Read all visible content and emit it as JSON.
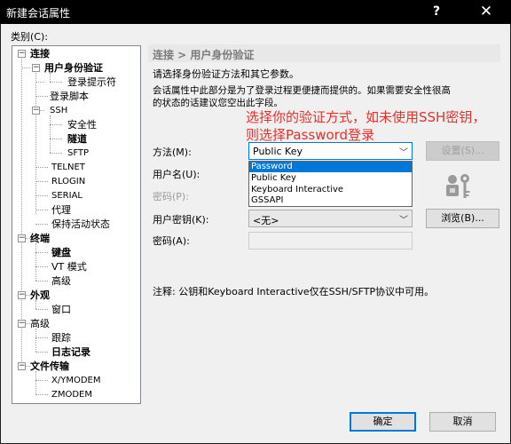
{
  "window": {
    "title": "新建会话属性",
    "help_glyph": "?",
    "close_glyph": "✕"
  },
  "category": {
    "label": "类别(C):",
    "items": [
      {
        "label": "连接",
        "expander": "−"
      },
      {
        "label": "用户身份验证",
        "expander": "−"
      },
      {
        "label": "登录提示符"
      },
      {
        "label": "登录脚本"
      },
      {
        "label": "SSH",
        "expander": "−"
      },
      {
        "label": "安全性"
      },
      {
        "label": "隧道"
      },
      {
        "label": "SFTP"
      },
      {
        "label": "TELNET"
      },
      {
        "label": "RLOGIN"
      },
      {
        "label": "SERIAL"
      },
      {
        "label": "代理"
      },
      {
        "label": "保持活动状态"
      },
      {
        "label": "终端",
        "expander": "−"
      },
      {
        "label": "键盘"
      },
      {
        "label": "VT 模式"
      },
      {
        "label": "高级"
      },
      {
        "label": "外观",
        "expander": "−"
      },
      {
        "label": "窗口"
      },
      {
        "label": "高级",
        "expander": "−"
      },
      {
        "label": "跟踪"
      },
      {
        "label": "日志记录"
      },
      {
        "label": "文件传输",
        "expander": "−"
      },
      {
        "label": "X/YMODEM"
      },
      {
        "label": "ZMODEM"
      }
    ]
  },
  "panel": {
    "breadcrumb": "连接 > 用户身份验证",
    "desc1": "请选择身份验证方法和其它参数。",
    "desc2": "会话属性中此部分是为了登录过程更便捷而提供的。如果需要安全性很高",
    "desc3": "的状态的话建议您空出此字段。",
    "annotation_line1": "选择你的验证方式，如未使用SSH密钥，",
    "annotation_line2": "则选择Password登录",
    "method_label": "方法(M):",
    "method_value": "Public Key",
    "method_options": [
      "Password",
      "Public Key",
      "Keyboard Interactive",
      "GSSAPI"
    ],
    "settings_button": "设置(S)...",
    "username_label": "用户名(U):",
    "password_label": "密码(P):",
    "userkey_label": "用户密钥(K):",
    "userkey_value": "<无>",
    "browse_button": "浏览(B)...",
    "passphrase_label": "密码(A):",
    "note": "注释: 公钥和Keyboard Interactive仅在SSH/SFTP协议中可用。"
  },
  "footer": {
    "ok_button": "确定",
    "cancel_button": "取消"
  },
  "colors": {
    "accent": "#0078d7",
    "annotation": "#e8302a"
  }
}
